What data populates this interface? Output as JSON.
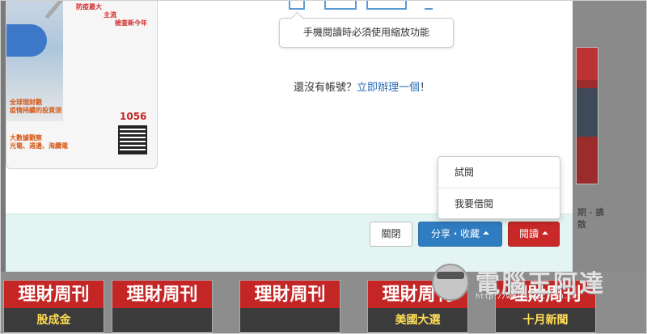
{
  "modal": {
    "tooltip": "手機閱讀時必須使用縮放功能",
    "signup_prompt": "還沒有帳號？",
    "signup_link": "立即辦理一個",
    "signup_suffix": "！",
    "buttons": {
      "close": "關閉",
      "share": "分享・收藏",
      "read": "閱讀"
    },
    "dropdown": {
      "items": [
        "試閱",
        "我要借閱"
      ]
    }
  },
  "cover": {
    "issue_number": "1056",
    "red_lines": [
      "防疫最大",
      "主流",
      "檢查新今年"
    ],
    "orange_lines": [
      "全球理財觀",
      "疫情持續的投資須"
    ],
    "orange_lines2": [
      "大數據觀察",
      "光電、週邊、海纜電"
    ]
  },
  "background": {
    "thumb_title": "理財周刊",
    "thumbs": [
      "股成金",
      "",
      "",
      "美國大選",
      "十月新聞"
    ],
    "right_text": "期 - 擴散"
  },
  "watermark": {
    "text": "電腦王阿達",
    "url": "http://www.kocpc.com.tw"
  },
  "colors": {
    "share_blue": "#2f7cc1",
    "read_red": "#c92828",
    "footer_bg": "#e4f4f2",
    "link_blue": "#2a6cb6"
  }
}
